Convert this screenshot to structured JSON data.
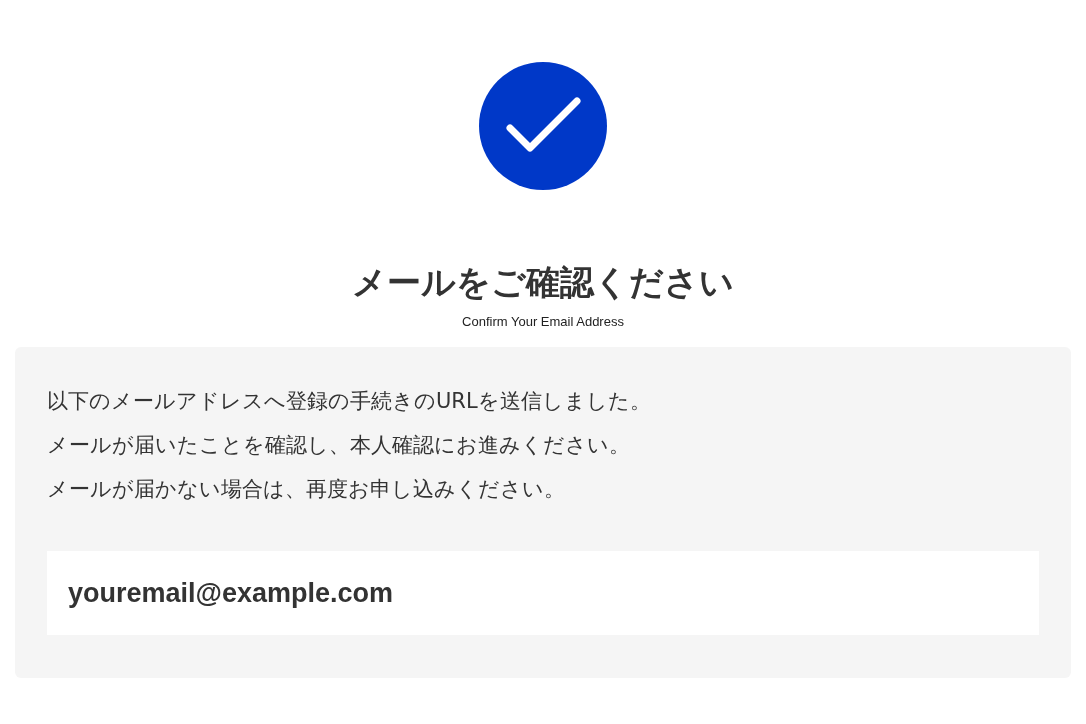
{
  "title": "メールをご確認ください",
  "subtitle": "Confirm Your Email Address",
  "message_lines": [
    "以下のメールアドレスへ登録の手続きのURLを送信しました。",
    "メールが届いたことを確認し、本人確認にお進みください。",
    "メールが届かない場合は、再度お申し込みください。"
  ],
  "email": "youremail@example.com"
}
